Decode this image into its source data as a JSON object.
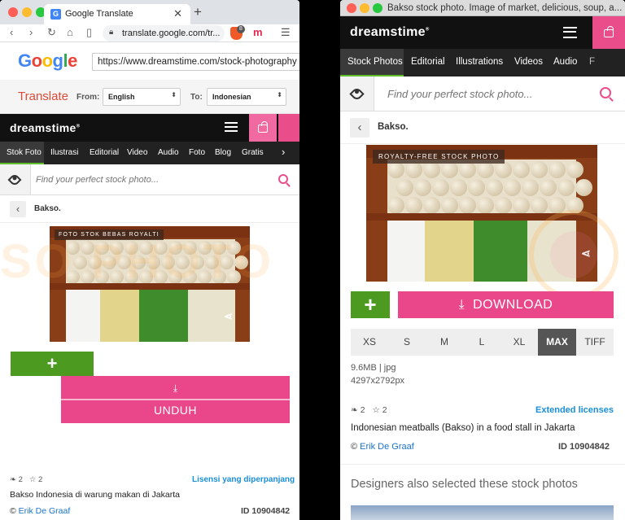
{
  "left": {
    "tab_title": "Google Translate",
    "url": "translate.google.com/tr...",
    "brave_count": "8",
    "google_query": "https://www.dreamstime.com/stock-photography",
    "translate_title": "Translate",
    "from_label": "From:",
    "from_value": "English",
    "to_label": "To:",
    "to_value": "Indonesian",
    "site": {
      "logo": "dreamstime",
      "nav": [
        "Stok Foto",
        "Ilustrasi",
        "Editorial",
        "Video",
        "Audio",
        "Foto",
        "Blog",
        "Gratis"
      ],
      "search_placeholder": "Find your perfect stock photo...",
      "breadcrumb": "Bakso.",
      "photo_badge": "FOTO STOK BEBAS ROYALTI",
      "download_label": "UNDUH",
      "download_icon": "download-icon",
      "likes": "2",
      "favorites": "2",
      "extended_licenses": "Lisensi yang diperpanjang",
      "description": "Bakso Indonesia di warung makan di Jakarta",
      "author_prefix": "©",
      "author": "Erik De Graaf",
      "image_id": "ID 10904842"
    }
  },
  "right": {
    "window_title": "Bakso stock photo. Image of market, delicious, soup, a...",
    "site": {
      "logo": "dreamstime",
      "nav": [
        "Stock Photos",
        "Editorial",
        "Illustrations",
        "Videos",
        "Audio",
        "F"
      ],
      "search_placeholder": "Find your perfect stock photo...",
      "breadcrumb": "Bakso.",
      "photo_badge": "ROYALTY-FREE STOCK PHOTO",
      "download_label": "DOWNLOAD",
      "sizes": [
        "XS",
        "S",
        "M",
        "L",
        "XL",
        "MAX",
        "TIFF"
      ],
      "selected_size": "MAX",
      "file_info": "9.6MB | jpg",
      "dimensions": "4297x2792px",
      "likes": "2",
      "favorites": "2",
      "extended_licenses": "Extended licenses",
      "description": "Indonesian meatballs (Bakso) in a food stall in Jakarta",
      "author_prefix": "©",
      "author": "Erik De Graaf",
      "image_id": "ID 10904842",
      "section_heading": "Designers also selected these stock photos"
    }
  },
  "colors": {
    "accent_pink": "#e9478a",
    "accent_green": "#4c9a1f",
    "link_blue": "#1a8fd9"
  }
}
